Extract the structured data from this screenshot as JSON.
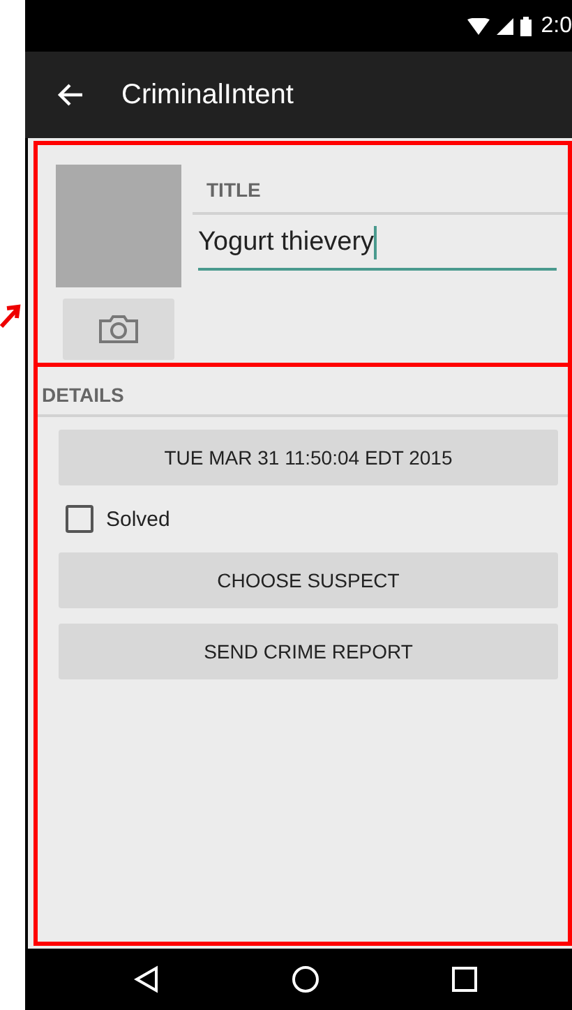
{
  "status_bar": {
    "time": "2:0"
  },
  "app_bar": {
    "title": "CriminalIntent"
  },
  "header": {
    "title_label": "TITLE",
    "title_value": "Yogurt thievery",
    "focused": true
  },
  "details": {
    "label": "DETAILS",
    "items": [
      {
        "kind": "button",
        "label": "TUE MAR 31 11:50:04 EDT 2015"
      },
      {
        "kind": "checkbox",
        "label": "Solved",
        "checked": false
      },
      {
        "kind": "button",
        "label": "CHOOSE SUSPECT"
      },
      {
        "kind": "button",
        "label": "SEND CRIME REPORT"
      }
    ]
  }
}
